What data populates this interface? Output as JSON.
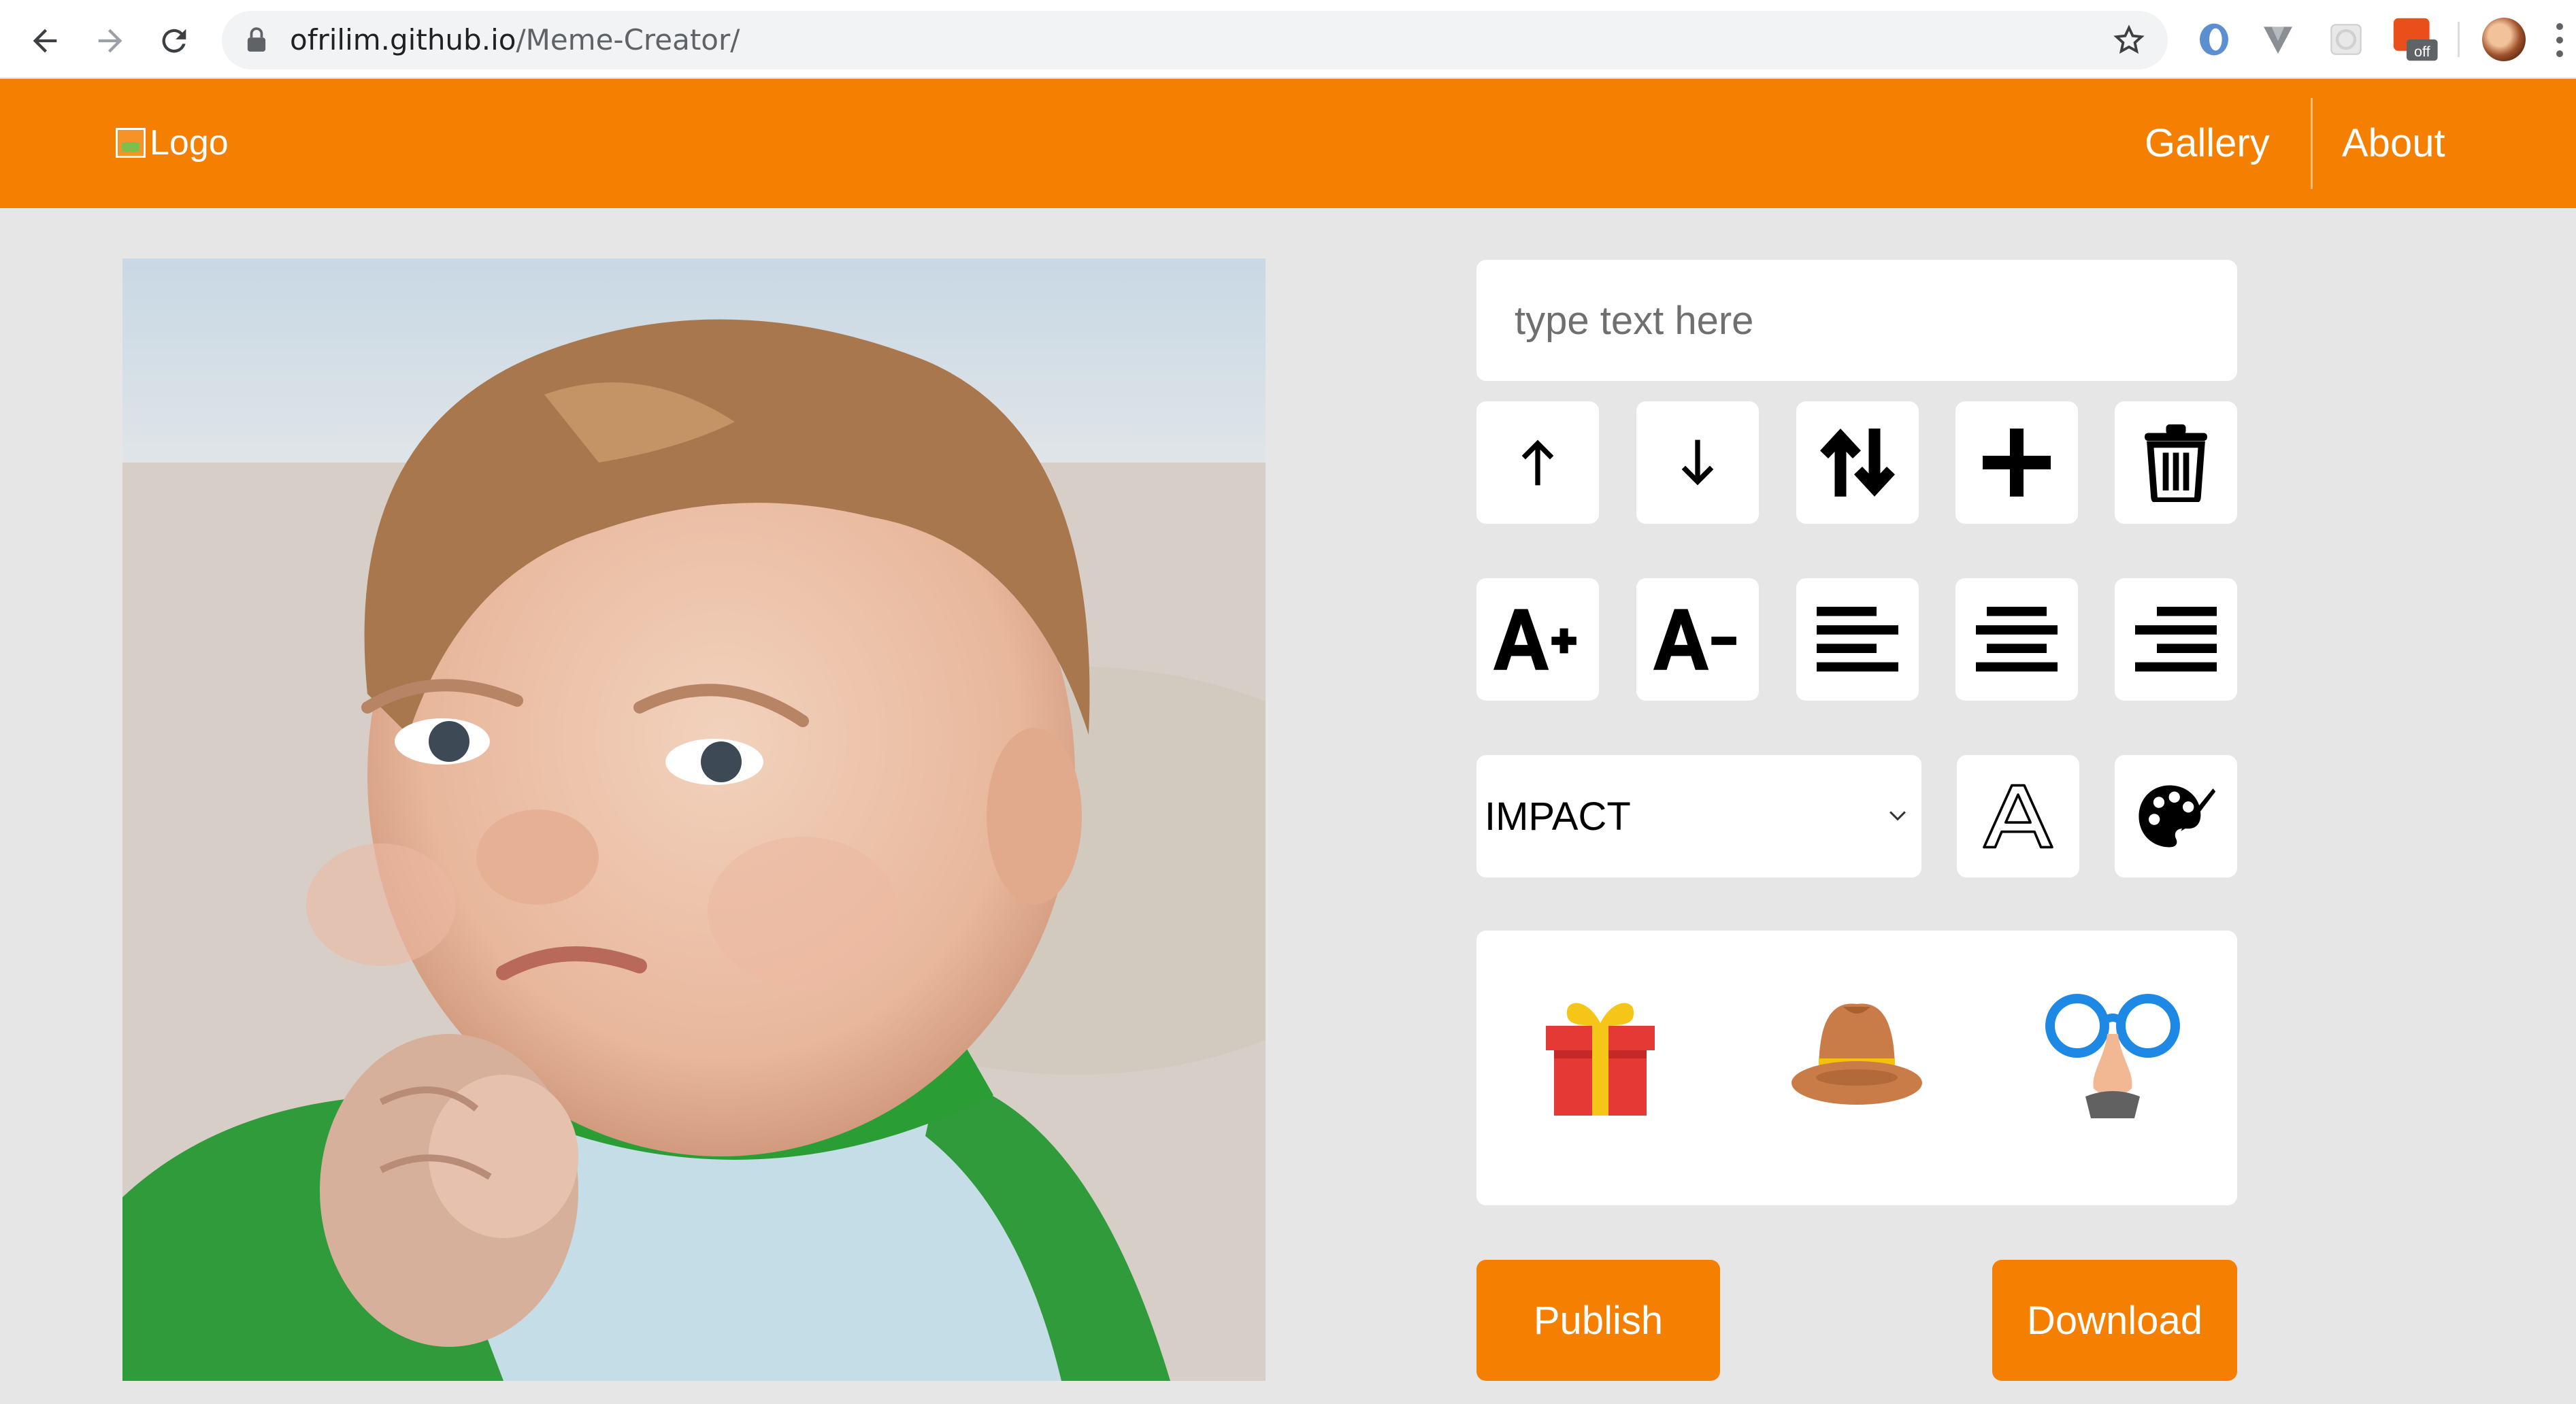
{
  "browser": {
    "url_host": "ofrilim.github.io",
    "url_path": "/Meme-Creator/",
    "extensions": [
      "opera-icon",
      "vuetify-icon",
      "extension-grid-icon",
      "stylus-off-icon"
    ],
    "extension_badge": "off"
  },
  "header": {
    "logo_alt": "Logo",
    "nav": [
      "Gallery",
      "About"
    ],
    "accent_color": "#f57f00"
  },
  "editor": {
    "text_placeholder": "type text here",
    "line_tools": [
      "arrow-up-icon",
      "arrow-down-icon",
      "swap-vertical-icon",
      "plus-icon",
      "trash-icon"
    ],
    "format_tools": [
      "font-increase-icon",
      "font-decrease-icon",
      "align-left-icon",
      "align-center-icon",
      "align-right-icon"
    ],
    "font": {
      "selected": "IMPACT"
    },
    "style_tools": [
      "stroke-font-icon",
      "palette-icon"
    ],
    "stickers": [
      "gift-icon",
      "hat-icon",
      "glasses-nose-icon"
    ],
    "actions": {
      "publish": "Publish",
      "download": "Download"
    }
  }
}
